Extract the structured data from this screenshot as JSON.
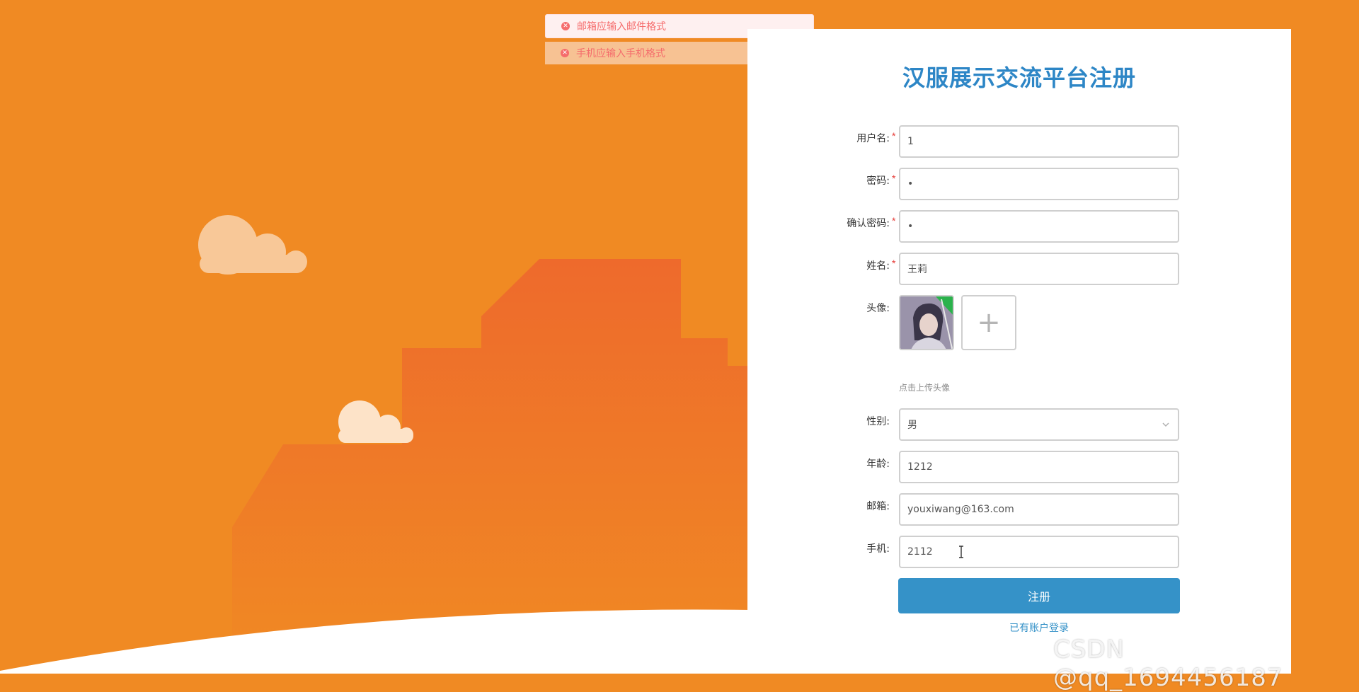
{
  "page": {
    "title": "汉服展示交流平台注册"
  },
  "messages": [
    {
      "text": "邮箱应输入邮件格式",
      "icon": "error-circle-icon"
    },
    {
      "text": "手机应输入手机格式",
      "icon": "error-circle-icon"
    }
  ],
  "form": {
    "username": {
      "label": "用户名:",
      "required": "*",
      "value": "1"
    },
    "password": {
      "label": "密码:",
      "required": "*",
      "value": "•"
    },
    "confirm_password": {
      "label": "确认密码:",
      "required": "*",
      "value": "•"
    },
    "name": {
      "label": "姓名:",
      "required": "*",
      "value": "王莉"
    },
    "avatar": {
      "label": "头像:",
      "upload_icon": "plus-icon",
      "upload_symbol": "+",
      "hint": "点击上传头像"
    },
    "gender": {
      "label": "性别:",
      "value": "男"
    },
    "age": {
      "label": "年龄:",
      "value": "1212"
    },
    "email": {
      "label": "邮箱:",
      "value": "youxiwang@163.com"
    },
    "phone": {
      "label": "手机:",
      "value": "2112"
    },
    "submit_label": "注册",
    "login_link": "已有账户登录"
  },
  "watermark": "CSDN @qq_1694456187",
  "colors": {
    "background": "#f08a23",
    "accent": "#3592c8",
    "error": "#f56c6c",
    "title": "#2d86c6"
  }
}
